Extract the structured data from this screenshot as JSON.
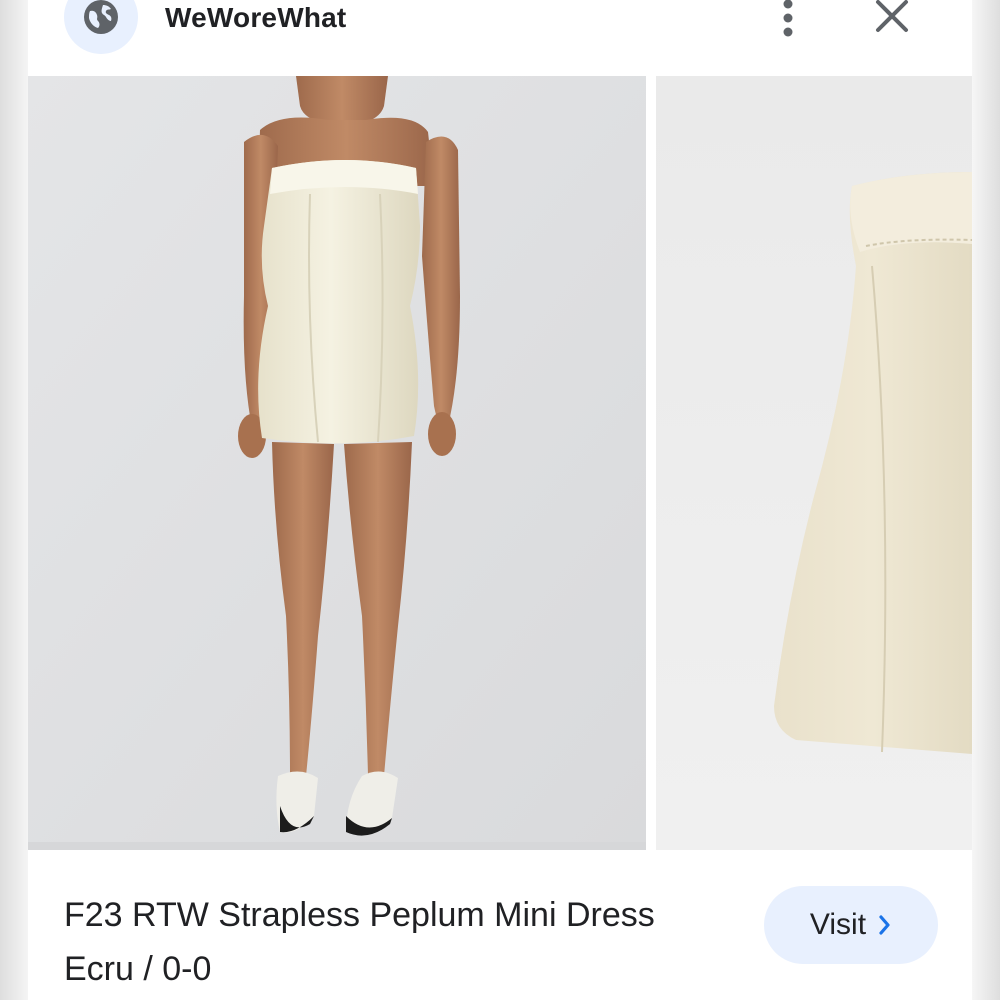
{
  "header": {
    "site_name": "WeWoreWhat",
    "site_icon": "globe-icon",
    "more_icon": "more-vert-icon",
    "close_icon": "close-icon"
  },
  "product": {
    "title": "F23 RTW Strapless Peplum Mini Dress Ecru / 0-0",
    "visit_label": "Visit",
    "visit_icon": "chevron-right-icon"
  },
  "colors": {
    "accent": "#1a73e8",
    "pill_background": "#e8f0fe",
    "text": "#202124",
    "photo_background": "#e6e7e9",
    "dress": "#f1ecd9"
  }
}
